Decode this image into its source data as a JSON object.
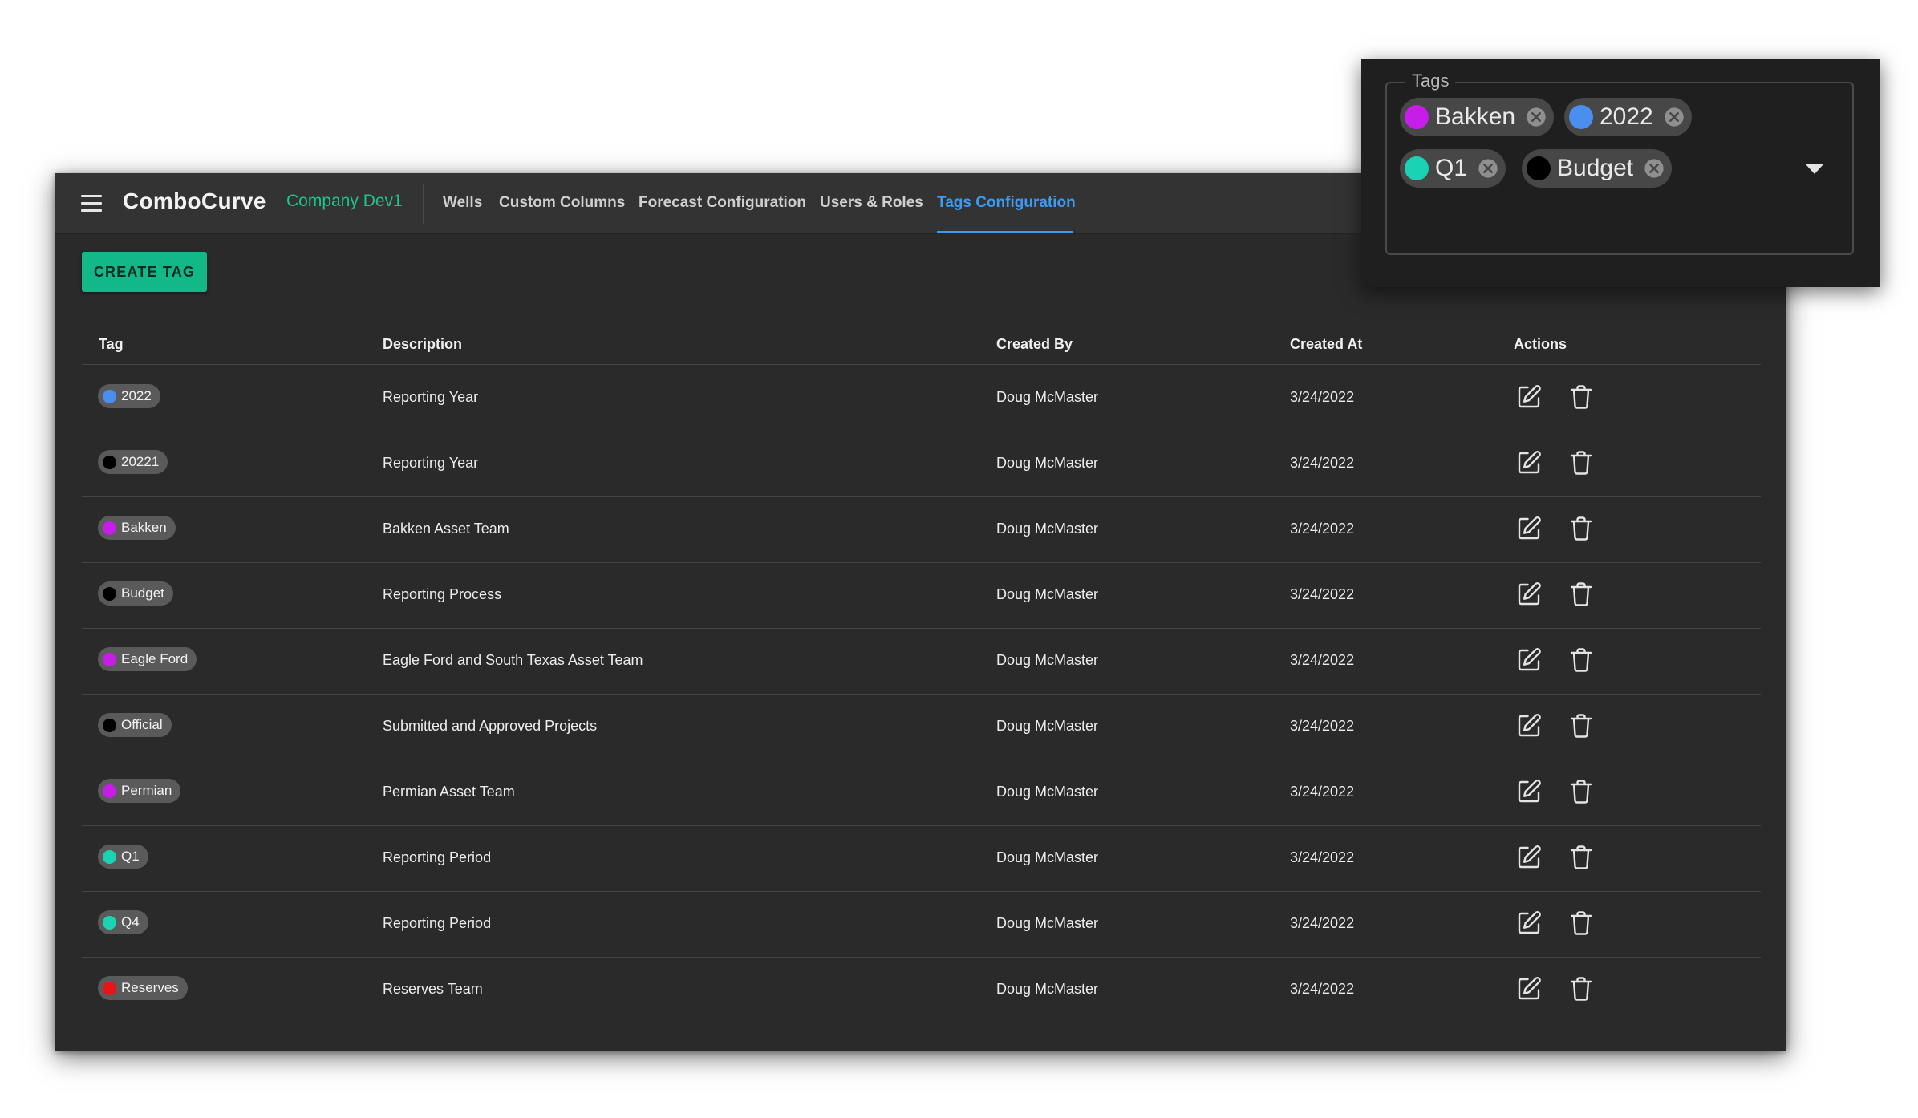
{
  "header": {
    "brand": "ComboCurve",
    "company": "Company Dev1",
    "nav": [
      {
        "label": "Wells"
      },
      {
        "label": "Custom Columns"
      },
      {
        "label": "Forecast Configuration"
      },
      {
        "label": "Users & Roles"
      },
      {
        "label": "Tags Configuration",
        "active": true
      }
    ]
  },
  "toolbar": {
    "create_label": "CREATE TAG"
  },
  "table": {
    "columns": {
      "tag": "Tag",
      "description": "Description",
      "created_by": "Created By",
      "created_at": "Created At",
      "actions": "Actions"
    },
    "rows": [
      {
        "tag": "2022",
        "color": "#4a8ef0",
        "description": "Reporting Year",
        "created_by": "Doug McMaster",
        "created_at": "3/24/2022"
      },
      {
        "tag": "20221",
        "color": "#000000",
        "description": "Reporting Year",
        "created_by": "Doug McMaster",
        "created_at": "3/24/2022"
      },
      {
        "tag": "Bakken",
        "color": "#c61ee8",
        "description": "Bakken Asset Team",
        "created_by": "Doug McMaster",
        "created_at": "3/24/2022"
      },
      {
        "tag": "Budget",
        "color": "#000000",
        "description": "Reporting Process",
        "created_by": "Doug McMaster",
        "created_at": "3/24/2022"
      },
      {
        "tag": "Eagle Ford",
        "color": "#c61ee8",
        "description": "Eagle Ford and South Texas Asset Team",
        "created_by": "Doug McMaster",
        "created_at": "3/24/2022"
      },
      {
        "tag": "Official",
        "color": "#000000",
        "description": "Submitted and Approved Projects",
        "created_by": "Doug McMaster",
        "created_at": "3/24/2022"
      },
      {
        "tag": "Permian",
        "color": "#c61ee8",
        "description": "Permian Asset Team",
        "created_by": "Doug McMaster",
        "created_at": "3/24/2022"
      },
      {
        "tag": "Q1",
        "color": "#19d3b4",
        "description": "Reporting Period",
        "created_by": "Doug McMaster",
        "created_at": "3/24/2022"
      },
      {
        "tag": "Q4",
        "color": "#19d3b4",
        "description": "Reporting Period",
        "created_by": "Doug McMaster",
        "created_at": "3/24/2022"
      },
      {
        "tag": "Reserves",
        "color": "#e8141a",
        "description": "Reserves Team",
        "created_by": "Doug McMaster",
        "created_at": "3/24/2022"
      }
    ],
    "row_actions": [
      "edit-icon",
      "trash-icon"
    ]
  },
  "tags_popup": {
    "legend": "Tags",
    "selected": [
      {
        "label": "Bakken",
        "color": "#c61ee8"
      },
      {
        "label": "2022",
        "color": "#4a8ef0"
      },
      {
        "label": "Q1",
        "color": "#19d3b4"
      },
      {
        "label": "Budget",
        "color": "#000000"
      }
    ],
    "remove_icon": "cancel-icon",
    "dropdown_icon": "caret-down-icon"
  }
}
